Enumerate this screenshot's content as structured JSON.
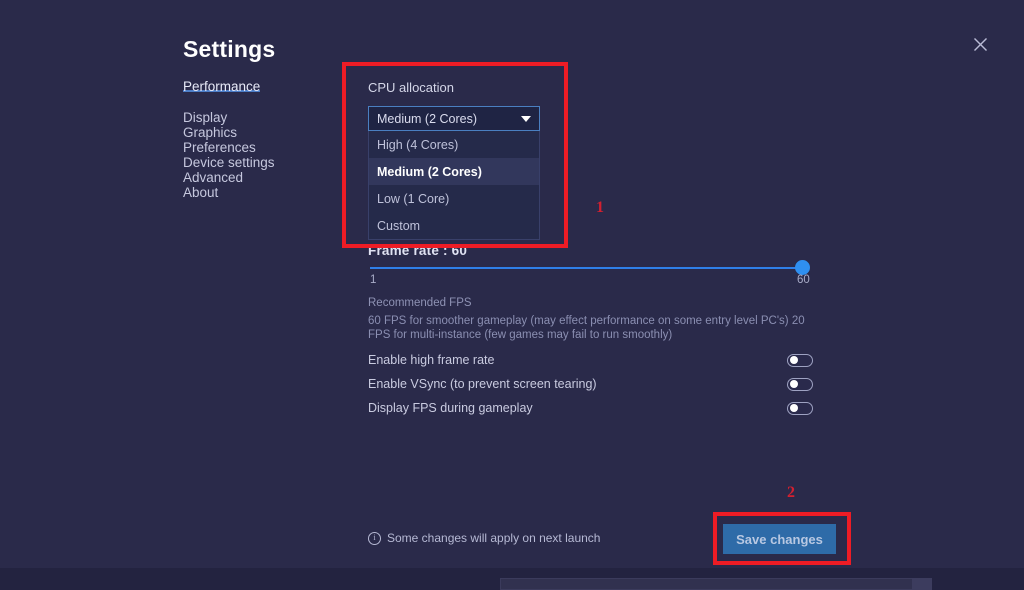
{
  "window": {
    "title": "Settings",
    "close_icon": "close-icon"
  },
  "sidebar": {
    "items": [
      {
        "label": "Performance",
        "active": true
      },
      {
        "label": "Display",
        "active": false
      },
      {
        "label": "Graphics",
        "active": false
      },
      {
        "label": "Preferences",
        "active": false
      },
      {
        "label": "Device settings",
        "active": false
      },
      {
        "label": "Advanced",
        "active": false
      },
      {
        "label": "About",
        "active": false
      }
    ]
  },
  "cpu_allocation": {
    "label": "CPU allocation",
    "selected": "Medium (2 Cores)",
    "expanded": true,
    "caret_icon": "chevron-down-icon",
    "options": [
      {
        "label": "High (4 Cores)",
        "selected": false
      },
      {
        "label": "Medium (2 Cores)",
        "selected": true
      },
      {
        "label": "Low (1 Core)",
        "selected": false
      },
      {
        "label": "Custom",
        "selected": false
      }
    ]
  },
  "frame_rate": {
    "title": "Frame rate : 60",
    "value": 60,
    "min_label": "1",
    "max_label": "60",
    "min": 1,
    "max": 60,
    "recommended_title": "Recommended FPS",
    "recommended_body": "60 FPS for smoother gameplay (may effect performance on some entry level PC's) 20 FPS for multi-instance (few games may fail to run smoothly)"
  },
  "toggles": [
    {
      "label": "Enable high frame rate",
      "on": false
    },
    {
      "label": "Enable VSync (to prevent screen tearing)",
      "on": false
    },
    {
      "label": "Display FPS during gameplay",
      "on": false
    }
  ],
  "footer": {
    "note": "Some changes will apply on next launch",
    "note_icon": "info-circle-icon",
    "save_label": "Save changes"
  },
  "annotations": [
    {
      "number": "1"
    },
    {
      "number": "2"
    }
  ],
  "colors": {
    "background": "#272746",
    "accent_blue": "#2f8ff0",
    "save_button": "#2e6ba8",
    "annotation_red": "#ee1c25"
  }
}
